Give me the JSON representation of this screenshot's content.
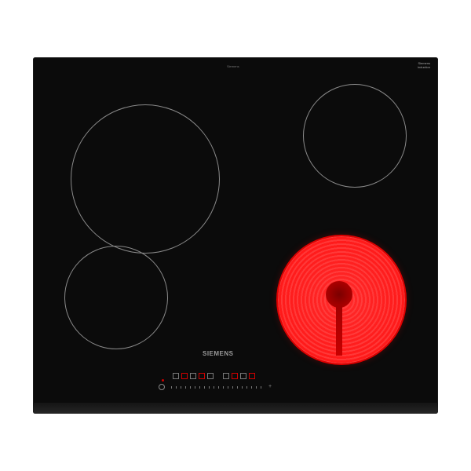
{
  "product": {
    "brand_label": "SIEMENS",
    "top_label": "Siemens",
    "badge_lines": [
      "Siemens",
      "induction"
    ]
  },
  "zones": [
    {
      "name": "back-left",
      "state": "off"
    },
    {
      "name": "back-right",
      "state": "off"
    },
    {
      "name": "front-left",
      "state": "off"
    },
    {
      "name": "front-right",
      "state": "on"
    }
  ],
  "colors": {
    "glass": "#0b0b0b",
    "zone_outline": "#8a8a8a",
    "heat_red": "#ff1a1a",
    "indicator_red": "#d00000"
  },
  "controls": {
    "power_icon": "power-icon",
    "plus_icon_label": "+"
  }
}
